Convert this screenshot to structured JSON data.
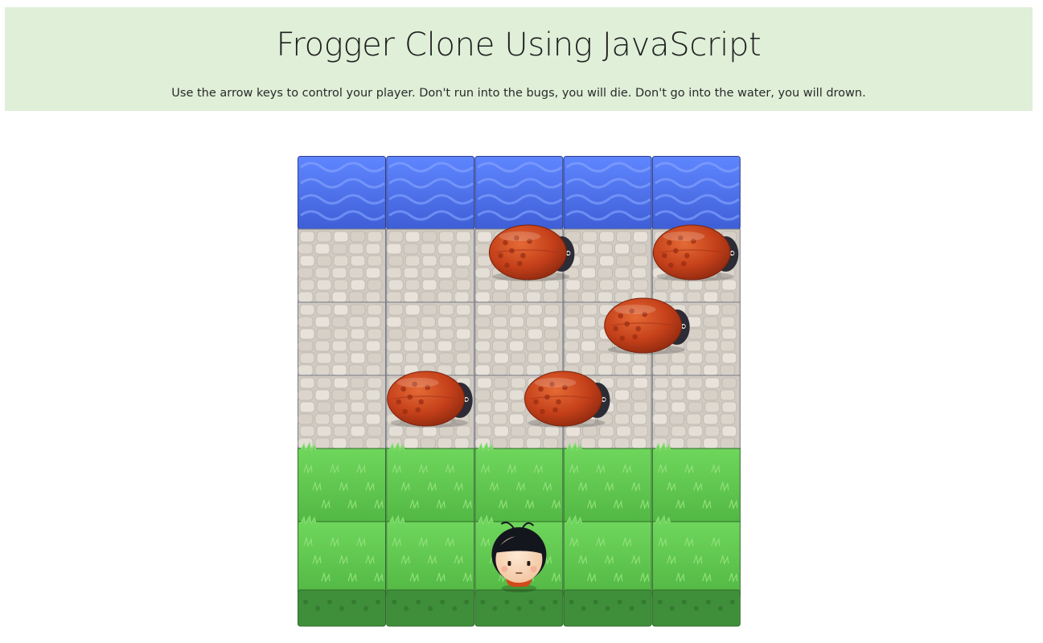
{
  "page": {
    "title": "Frogger Clone Using JavaScript",
    "instructions": "Use the arrow keys to control your player. Don't run into the bugs, you will die. Don't go into the water, you will drown."
  },
  "game": {
    "grid": {
      "cols": 5,
      "rows": 6
    },
    "rows": [
      "water",
      "stone",
      "stone",
      "stone",
      "grass",
      "grass"
    ],
    "colors": {
      "header_bg": "#dfefd8",
      "water": "#4a6de0",
      "stone": "#d9d4cc",
      "grass": "#5cc24d",
      "bug": "#c9431a",
      "soil": "#3f8f3a"
    },
    "icons": {
      "water": "water-tile",
      "stone": "stone-tile",
      "grass": "grass-tile",
      "enemy": "ladybug-icon",
      "player": "boy-character-icon"
    },
    "enemies": [
      {
        "row": 1,
        "col": 2.1
      },
      {
        "row": 1,
        "col": 3.95
      },
      {
        "row": 2,
        "col": 3.4
      },
      {
        "row": 3,
        "col": 2.5
      },
      {
        "row": 3,
        "col": 0.95
      }
    ],
    "player": {
      "row": 5,
      "col": 2
    }
  }
}
